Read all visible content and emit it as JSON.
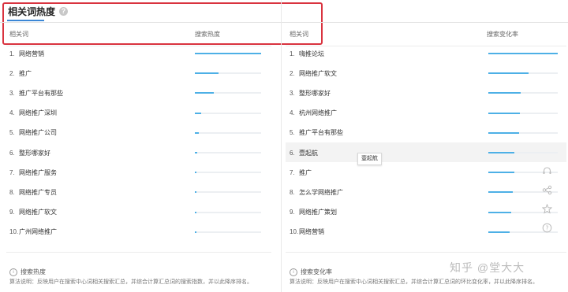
{
  "header": {
    "title": "相关词热度",
    "help_icon": "?"
  },
  "left": {
    "col1": "相关词",
    "col2": "搜索热度",
    "rows": [
      {
        "num": "1.",
        "term": "网络营销",
        "value": 1.0
      },
      {
        "num": "2.",
        "term": "推广",
        "value": 0.36
      },
      {
        "num": "3.",
        "term": "推广平台有那些",
        "value": 0.29
      },
      {
        "num": "4.",
        "term": "网络推广深圳",
        "value": 0.1
      },
      {
        "num": "5.",
        "term": "网络推广公司",
        "value": 0.06
      },
      {
        "num": "6.",
        "term": "整形哪家好",
        "value": 0.03
      },
      {
        "num": "7.",
        "term": "网络推广服务",
        "value": 0.02
      },
      {
        "num": "8.",
        "term": "网络推广专员",
        "value": 0.015
      },
      {
        "num": "9.",
        "term": "网络推广软文",
        "value": 0.01
      },
      {
        "num": "10.",
        "term": "广州网络推广",
        "value": 0.01
      }
    ],
    "note_title": "搜索热度",
    "note_body": "算法说明：反映用户在搜索中心词相关搜索汇总，并综合计算汇总词的搜索指数，并以此降序排名。"
  },
  "right": {
    "col1": "相关词",
    "col2": "搜索变化率",
    "rows": [
      {
        "num": "1.",
        "term": "嗨推论坛",
        "value": 1.0
      },
      {
        "num": "2.",
        "term": "网络推广软文",
        "value": 0.58
      },
      {
        "num": "3.",
        "term": "整形哪家好",
        "value": 0.47
      },
      {
        "num": "4.",
        "term": "杭州网络推广",
        "value": 0.46
      },
      {
        "num": "5.",
        "term": "推广平台有那些",
        "value": 0.44
      },
      {
        "num": "6.",
        "term": "壹起航",
        "value": 0.38
      },
      {
        "num": "7.",
        "term": "推广",
        "value": 0.37
      },
      {
        "num": "8.",
        "term": "怎么学网络推广",
        "value": 0.35
      },
      {
        "num": "9.",
        "term": "网络推广策划",
        "value": 0.33
      },
      {
        "num": "10.",
        "term": "网络营销",
        "value": 0.31
      }
    ],
    "tooltip": "壹起航",
    "note_title": "搜索变化率",
    "note_body": "算法说明：反映用户在搜索中心词相关搜索汇总，并综合计算汇总词的环比变化率，并以此降序排名。"
  },
  "watermark": "知乎 @堂大大",
  "colors": {
    "bar": "#4db0e6",
    "track": "#eceff2",
    "highlight": "#d9333f",
    "accent": "#3b87d6"
  },
  "side_icons": [
    "headset-icon",
    "share-icon",
    "star-icon",
    "help-circle-icon"
  ]
}
